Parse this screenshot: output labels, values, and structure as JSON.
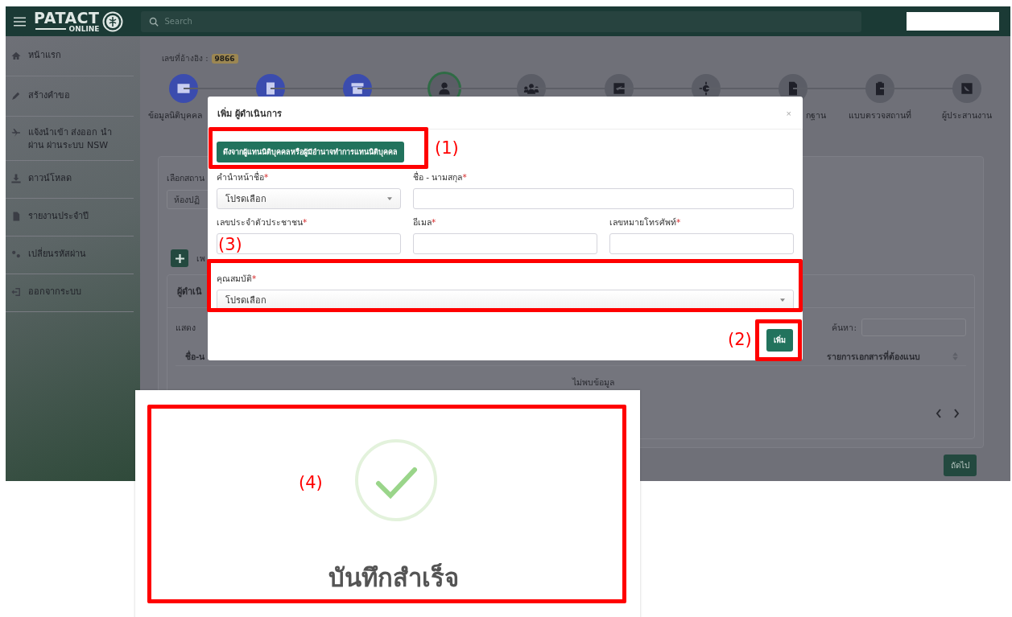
{
  "header": {
    "logo_text": "PATACT",
    "logo_subtext": "ONLINE",
    "search": {
      "placeholder": "Search"
    }
  },
  "sidebar": {
    "items": [
      {
        "label": "หน้าแรก"
      },
      {
        "label": "สร้างคำขอ"
      },
      {
        "label": "แจ้งนำเข้า ส่งออก นำผ่าน ผ่านระบบ NSW"
      },
      {
        "label": "ดาวน์โหลด"
      },
      {
        "label": "รายงานประจำปี"
      },
      {
        "label": "เปลี่ยนรหัสผ่าน"
      },
      {
        "label": "ออกจากระบบ"
      }
    ]
  },
  "reference": {
    "label": "เลขที่อ้างอิง :",
    "value": "9866"
  },
  "steps": [
    {
      "done": true,
      "selected": false,
      "label": "ข้อมูลนิติบุคคล"
    },
    {
      "done": true,
      "selected": false
    },
    {
      "done": true,
      "selected": false
    },
    {
      "done": false,
      "selected": true
    },
    {
      "done": false,
      "selected": false
    },
    {
      "done": false,
      "selected": false
    },
    {
      "done": false,
      "selected": false
    },
    {
      "done": false,
      "selected": false,
      "label": "กฐาน"
    },
    {
      "done": false,
      "selected": false,
      "label": "แบบตรวจสถานที่"
    },
    {
      "done": false,
      "selected": false,
      "label": "ผู้ประสานงาน"
    }
  ],
  "form_card": {
    "location_label": "เลือกสถาน",
    "location_value": "ห้องปฏิ",
    "add_label": "เพ",
    "table_card": {
      "title": "ผู้ดำเนิ",
      "show_label": "แสดง",
      "search_label": "ค้นหา:",
      "columns": [
        "ชื่อ-น",
        "รายการเอกสารที่ต้องแนบ"
      ],
      "empty_text": "ไม่พบข้อมูล"
    }
  },
  "next_button": "ถัดไป",
  "modal": {
    "title": "เพิ่ม ผู้ดำเนินการ",
    "close": "×",
    "import_button": "ดึงจากผู้แทนนิติบุคคลหรือผู้มีอำนาจทำการแทนนิติบุคคล",
    "fields": [
      {
        "kind": "select",
        "label": "คำนำหน้าชื่อ",
        "required_mark": "*",
        "value": "โปรดเลือก"
      },
      {
        "kind": "text",
        "label": "ชื่อ - นามสกุล",
        "required_mark": "*"
      },
      {
        "kind": "text",
        "label": "เลขประจำตัวประชาชน",
        "required_mark": "*"
      },
      {
        "kind": "text",
        "label": "อีเมล",
        "required_mark": "*"
      },
      {
        "kind": "text",
        "label": "เลขหมายโทรศัพท์",
        "required_mark": "*"
      },
      {
        "kind": "select",
        "label": "คุณสมบัติ",
        "required_mark": "*",
        "value": "โปรดเลือก"
      }
    ],
    "submit_button": "เพิ่ม"
  },
  "annotations": [
    {
      "label": "(1)"
    },
    {
      "label": "(2)"
    },
    {
      "label": "(3)"
    },
    {
      "label": "(4)"
    }
  ],
  "success": {
    "message": "บันทึกสำเร็จ"
  }
}
